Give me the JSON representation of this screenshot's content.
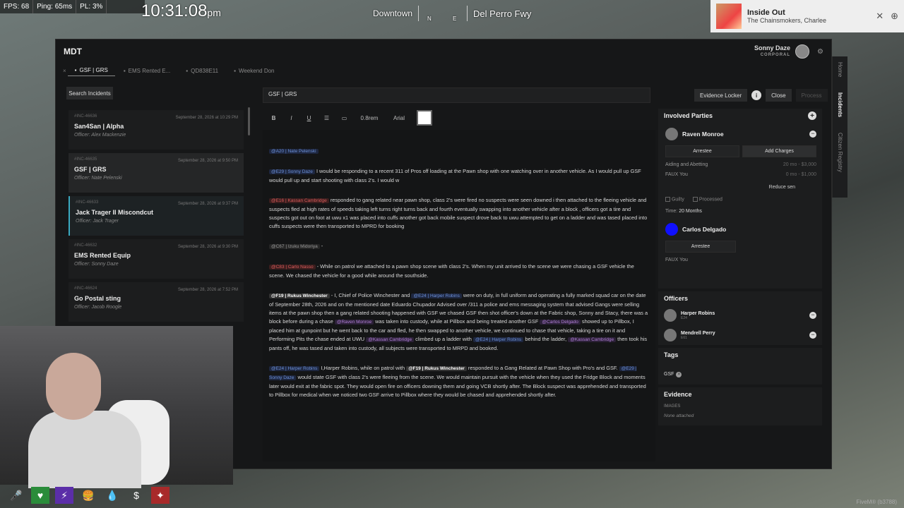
{
  "hud": {
    "fps": "FPS: 68",
    "ping": "Ping: 65ms",
    "pl": "PL: 3%",
    "clock": "10:31:08",
    "ampm": "pm",
    "zone": "Downtown",
    "street": "Del Perro Fwy",
    "compass_n": "N",
    "compass_e": "E"
  },
  "music": {
    "title": "Inside Out",
    "artist": "The Chainsmokers, Charlee"
  },
  "mdt": {
    "title": "MDT",
    "user_name": "Sonny Daze",
    "user_rank": "CORPORAL",
    "tabs": [
      {
        "label": "GSF | GRS"
      },
      {
        "label": "EMS Rented E..."
      },
      {
        "label": "QD838E11"
      },
      {
        "label": "Weekend Don"
      }
    ],
    "nav": [
      "Home",
      "Incidents",
      "Citizen Registry"
    ]
  },
  "incidents": {
    "search_label": "Search Incidents",
    "items": [
      {
        "id": "#INC-46636",
        "date": "September 28, 2026 at 10:29 PM",
        "title": "San4San | Alpha",
        "officer": "Officer: Alex Mackenzie"
      },
      {
        "id": "#INC-46635",
        "date": "September 28, 2026 at 9:50 PM",
        "title": "GSF | GRS",
        "officer": "Officer: Nate Pelenski"
      },
      {
        "id": "#INC-46633",
        "date": "September 28, 2026 at 9:37 PM",
        "title": "Jack Trager II Miscondcut",
        "officer": "Officer: Jack Trager"
      },
      {
        "id": "#INC-46632",
        "date": "September 28, 2026 at 9:30 PM",
        "title": "EMS Rented Equip",
        "officer": "Officer: Sonny Daze"
      },
      {
        "id": "#INC-46624",
        "date": "September 28, 2026 at 7:52 PM",
        "title": "Go Postal sting",
        "officer": "Officer: Jacob Roogle"
      }
    ]
  },
  "editor": {
    "title_value": "GSF | GRS",
    "font_size": "0.8rem",
    "font_name": "Arial",
    "tag_a20": "@A20 | Nate Pelenski",
    "tag_e29": "@E29 | Sonny Daze",
    "p1": "I would be responding to a recent 311 of Pros off loading at the Pawn shop with one watching over in another vehicle. As I would pull up GSF would pull up and start shooting with class 2's. I would w",
    "tag_red1": "@E16 | Kassan Cambridge",
    "p2": "responded to gang related near pawn shop, class 2's were fired no suspects were seen downed i then attached to the fleeing vehicle and suspects fled at high rates of speeds taking left turns right turns back and fourth eventually swapping into another vehicle after a block , officers got a tire and suspects got out on foot at uwu x1 was placed into cuffs another got back mobile suspect drove back to uwu attempted to get on a ladder and was tased placed into cuffs suspects were then transported to MPRD for booking",
    "tag_c67": "@C67 | Izuku Midoriya",
    "p3_sep": "-",
    "tag_red2": "@C83 | Carlo Nasso",
    "p3": "- While on patrol we attached to a pawn shop scene with class 2's. When my unit arrived to the scene we were chasing a GSF vehicle the scene. We chased the vehicle for a good while around the southside.",
    "tag_f19": "@F19 | Rukus Winchester",
    "p4a": "- I, Chief of Police Winchester and",
    "tag_e24": "@E24 | Harper Robins",
    "p4b": "were on duty, in full uniform and operating a fully marked squad car on the date of September 28th, 2026 and on the mentioned date Eduardo Chupador Advised over /311 a police and ems messaging system that advised Gangs were selling items at the pawn shop then a gang related shooting happened with GSF we chased GSF then shot officer's down at the Fabric shop, Sonny and Stacy, there was a block before during a chase",
    "tag_raven": "@Raven Monroe",
    "p4c": "was taken into custody, while at Pillbox and being treated another GSF",
    "tag_carlos": "@Carlos Delgado",
    "p4d": "showed up to Pillbox, I placed him at gunpoint but he went back to the car and fled, he then swapped to another vehicle, we continued to chase that vehicle, taking a tire on it and Performing Pits the chase ended at UWU",
    "tag_kassan": "@Kassan Cambridge",
    "p4e": "climbed up a ladder with",
    "tag_e24b": "@E24 | Harper Robins",
    "p4f": "behind the ladder,",
    "tag_kassan2": "@Kassan Cambridge",
    "p4g": "then took his pants off, he was tased and taken into custody, all subjects were transported to MRPD and booked.",
    "tag_e24c": "@E24 | Harper Robins",
    "p5a": "I,Harper Robins, while on patrol with",
    "tag_f19b": "@F19 | Rukus Winchester",
    "p5b": "responded to a Gang Related at Pawn Shop with Pro's and GSF.",
    "tag_e29b": "@E29 | Sonny Daze",
    "p5c": "would state GSF with class 2's were fleeing from the scene. We would maintain pursuit with the vehicle when they used the Fridge Block and moments later would exit at the fabric spot. They would open fire on officers downing them and going VCB shortly after. The Block suspect was apprehended and transported to Pillbox for medical when we noticed two GSF arrive to Pillbox where they would be chased and apprehended shortly after."
  },
  "actions": {
    "evidence_locker": "Evidence Locker",
    "info": "i",
    "close": "Close",
    "process": "Process"
  },
  "parties": {
    "heading": "Involved Parties",
    "people": [
      {
        "name": "Raven Monroe",
        "role": "Arrestee",
        "add_charges": "Add Charges",
        "charges": [
          {
            "name": "Aiding and Abetting",
            "amt": "20 mo - $3,000"
          },
          {
            "name": "FAUX You",
            "amt": "0 mo - $1,000"
          }
        ],
        "reduce": "Reduce sen",
        "guilty": "Guilty",
        "processed": "Processed",
        "time_label": "Time:",
        "time_value": "20 Months"
      },
      {
        "name": "Carlos Delgado",
        "role": "Arrestee",
        "charge": "FAUX You"
      }
    ]
  },
  "officers": {
    "heading": "Officers",
    "list": [
      {
        "name": "Harper Robins",
        "sub": "E24"
      },
      {
        "name": "Mendrell Perry",
        "sub": "E61"
      }
    ]
  },
  "tags": {
    "heading": "Tags",
    "items": [
      "GSF"
    ]
  },
  "evidence": {
    "heading": "Evidence",
    "images_label": "IMAGES",
    "none": "None attached"
  },
  "footer": {
    "fivem": "FiveM® (b3788)"
  },
  "colors": {
    "accent": "#3aa9c0",
    "panel_bg": "#161718",
    "tag_blue": "#6b8fd6",
    "tag_red": "#d65a5a",
    "tag_purple": "#b07ed6"
  }
}
